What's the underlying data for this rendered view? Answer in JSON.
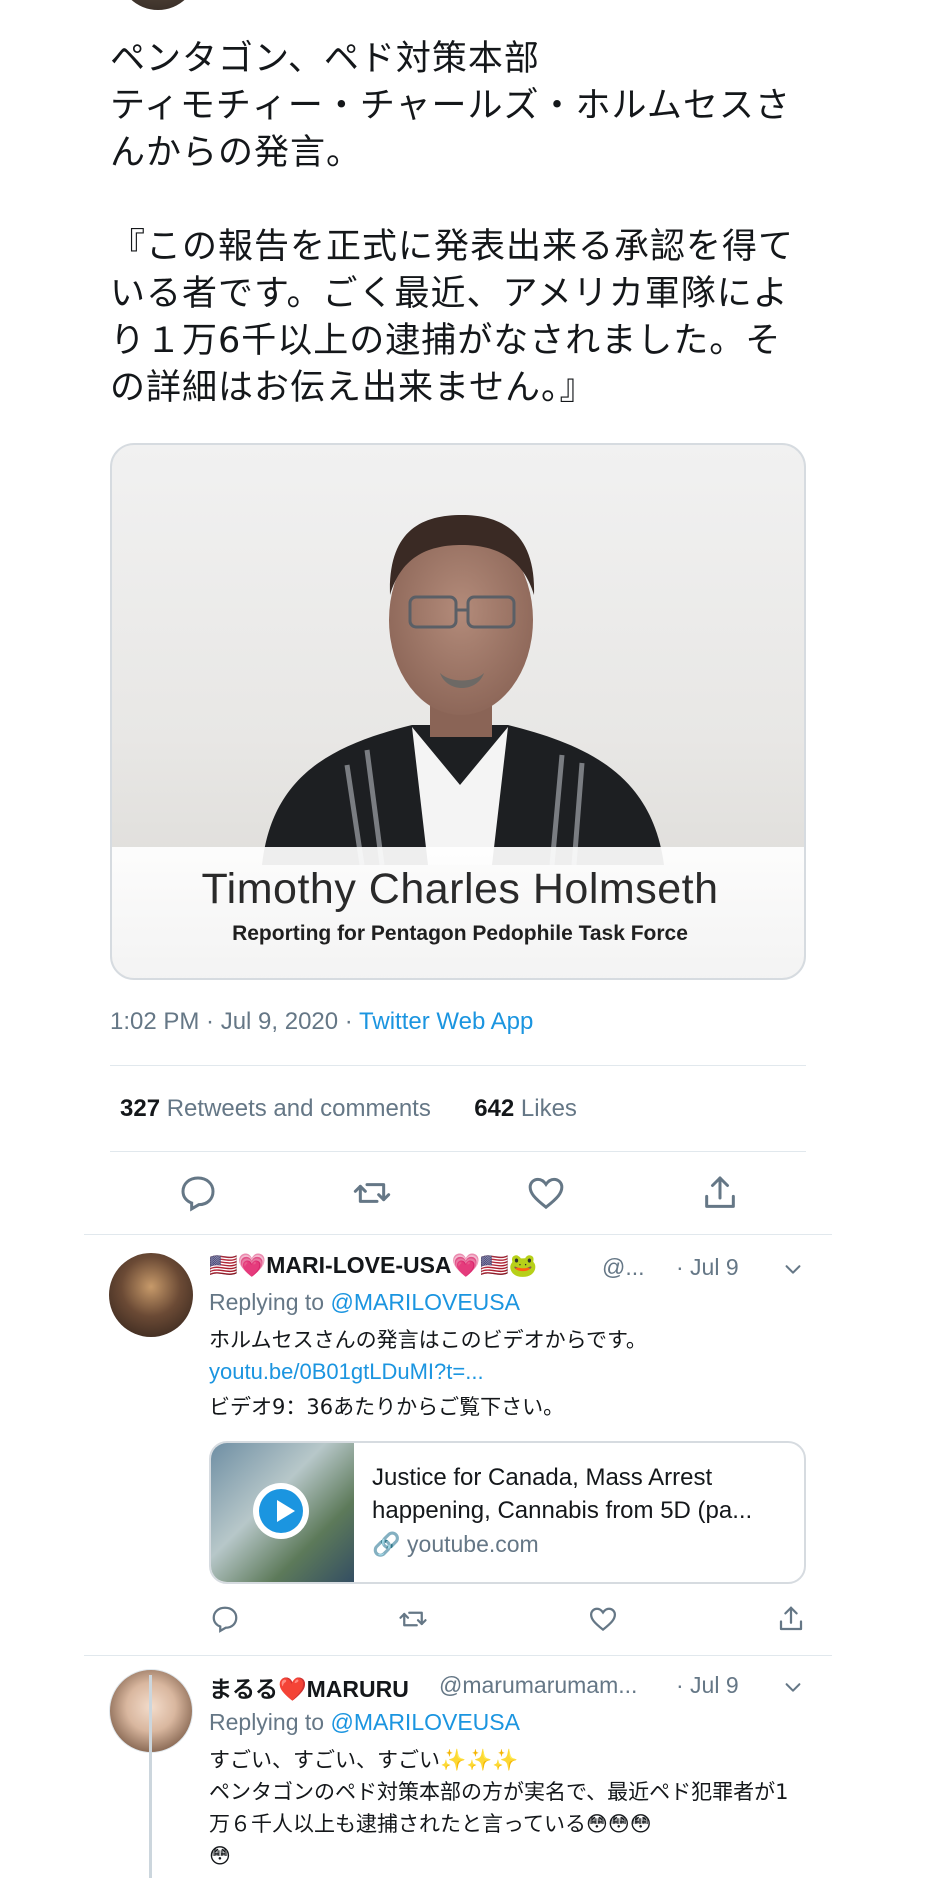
{
  "tweet": {
    "text": "ペンタゴン、ペド対策本部\nティモチィー・チャールズ・ホルムセスさんからの発言。\n\n『この報告を正式に発表出来る承認を得ている者です。ごく最近、アメリカ軍隊により１万6千以上の逮捕がなされました。その詳細はお伝え出来ません。』",
    "media": {
      "caption_name": "Timothy Charles Holmseth",
      "caption_sub": "Reporting for Pentagon Pedophile Task Force"
    },
    "time": "1:02 PM · Jul 9, 2020 · ",
    "source": "Twitter Web App",
    "retweets_count": "327",
    "retweets_label": " Retweets and comments",
    "likes_count": "642",
    "likes_label": " Likes",
    "actions": [
      "reply-icon",
      "retweet-icon",
      "like-icon",
      "share-icon"
    ]
  },
  "replies": [
    {
      "name": "🇺🇸💗MARI-LOVE-USA💗🇺🇸🐸",
      "handle": "@...",
      "date": "· Jul 9",
      "replying_prefix": "Replying to ",
      "replying_to": "@MARILOVEUSA",
      "text1": "ホルムセスさんの発言はこのビデオからです。",
      "link": "youtu.be/0B01gtLDuMI?t=...",
      "text2": "ビデオ9：36あたりからご覧下さい。",
      "card": {
        "title": "Justice for Canada, Mass Arrest happening, Cannabis from 5D (pa...",
        "domain": "youtube.com"
      }
    },
    {
      "name": "まるる❤️MARURU",
      "handle": "@marumarumam...",
      "date": "· Jul 9",
      "replying_prefix": "Replying to ",
      "replying_to": "@MARILOVEUSA",
      "text": "すごい、すごい、すごい✨✨✨\nペンタゴンのペド対策本部の方が実名で、最近ペド犯罪者が1万６千人以上も逮捕されたと言っている😳😳😳\n😳"
    }
  ],
  "colors": {
    "link": "#1b95e0",
    "muted": "#657786",
    "divider": "#e1e8ed"
  }
}
